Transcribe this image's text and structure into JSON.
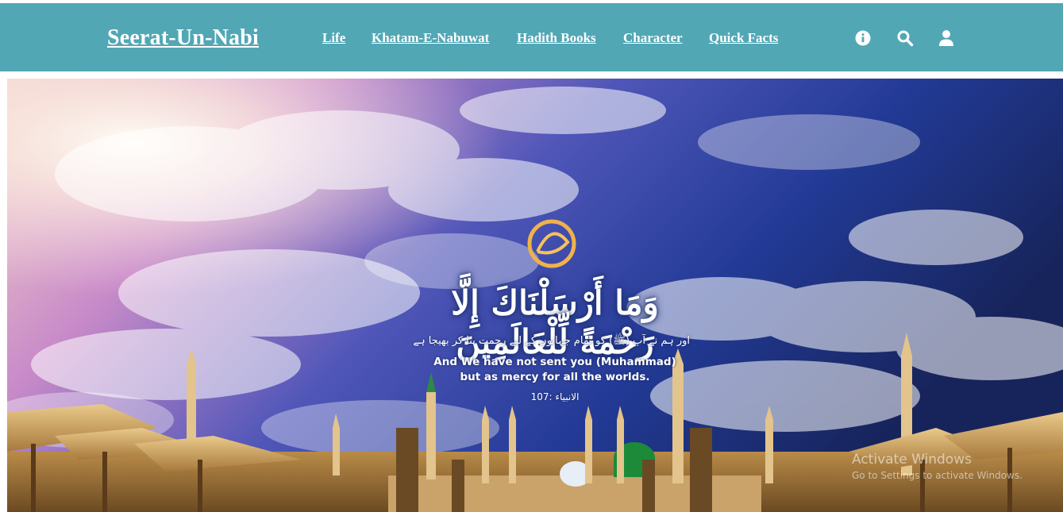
{
  "brand": {
    "title": "Seerat-Un-Nabi"
  },
  "nav": {
    "links": [
      "Life",
      "Khatam-E-Nabuwat",
      "Hadith Books",
      "Character",
      "Quick Facts"
    ],
    "icons": [
      "info-icon",
      "search-icon",
      "user-icon"
    ]
  },
  "hero": {
    "calligraphy": "وَمَا أَرْسَلْنَاكَ إِلَّا رَحْمَةً لِّلْعَالَمِينَ",
    "urdu": "اور ہم نے آپ (ﷺ) کو تمام جہانوں کے لیے رحمت بنا کر بھیجا ہے",
    "english_line1": "And We have not sent you (Muhammad)",
    "english_line2": "but as mercy for all the worlds.",
    "reference": "الانبیاء :107"
  },
  "watermark": {
    "title": "Activate Windows",
    "subtitle": "Go to Settings to activate Windows."
  },
  "colors": {
    "navbar": "#52a7b5",
    "text": "#ffffff"
  }
}
